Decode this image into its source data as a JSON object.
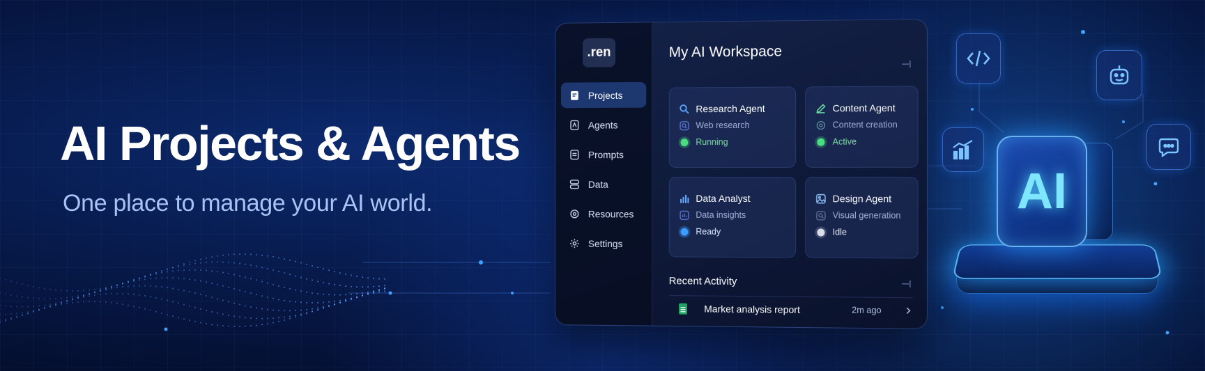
{
  "hero": {
    "title": "AI Projects & Agents",
    "subtitle": "One place to manage your AI world."
  },
  "app": {
    "logo": ".ren",
    "workspace_title": "My AI Workspace",
    "sidebar": {
      "items": [
        {
          "label": "Projects",
          "icon": "folder-doc-icon",
          "active": true
        },
        {
          "label": "Agents",
          "icon": "agent-doc-icon",
          "active": false
        },
        {
          "label": "Prompts",
          "icon": "prompt-doc-icon",
          "active": false
        },
        {
          "label": "Data",
          "icon": "database-icon",
          "active": false
        },
        {
          "label": "Resources",
          "icon": "resources-icon",
          "active": false
        },
        {
          "label": "Settings",
          "icon": "gear-icon",
          "active": false
        }
      ]
    },
    "agents": [
      {
        "name": "Research Agent",
        "icon": "search-icon",
        "desc": "Web research",
        "desc_icon": "globe-search-icon",
        "status": "Running",
        "status_color": "#4ade80"
      },
      {
        "name": "Content Agent",
        "icon": "pen-icon",
        "desc": "Content creation",
        "desc_icon": "content-icon",
        "status": "Active",
        "status_color": "#4ade80"
      },
      {
        "name": "Data Analyst",
        "icon": "bar-chart-icon",
        "desc": "Data insights",
        "desc_icon": "insights-icon",
        "status": "Ready",
        "status_color": "#3b9bff"
      },
      {
        "name": "Design Agent",
        "icon": "image-icon",
        "desc": "Visual generation",
        "desc_icon": "visual-icon",
        "status": "Idle",
        "status_color": "#d8dde8"
      }
    ],
    "recent": {
      "title": "Recent Activity",
      "items": [
        {
          "label": "Market analysis report",
          "icon": "spreadsheet-icon",
          "time": "2m ago"
        }
      ]
    }
  },
  "floating_icons": [
    "code-icon",
    "robot-icon",
    "analytics-icon",
    "chat-icon"
  ],
  "ai_cube_label": "AI",
  "colors": {
    "background": "#061445",
    "accent": "#3b9bff",
    "status_green": "#4ade80",
    "cube_glow": "#7fe6ff"
  }
}
